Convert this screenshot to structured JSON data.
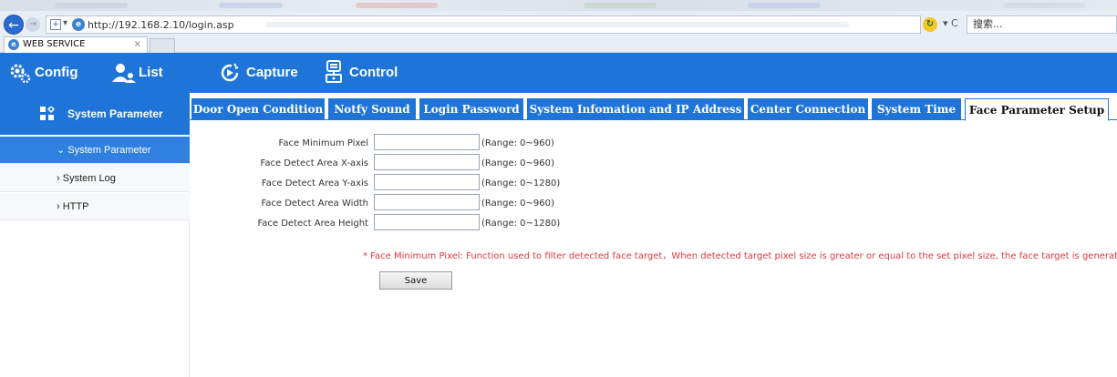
{
  "browser": {
    "url": "http://192.168.2.10/login.asp",
    "search_placeholder": "搜索...",
    "tab_title": "WEB SERVICE",
    "tab_close": "×"
  },
  "header": {
    "items": [
      {
        "label": "Config",
        "icon": "gear-icon"
      },
      {
        "label": "List",
        "icon": "users-icon"
      },
      {
        "label": "Capture",
        "icon": "capture-icon"
      },
      {
        "label": "Control",
        "icon": "control-icon"
      }
    ]
  },
  "sidebar": {
    "title": "System Parameter",
    "items": [
      {
        "label": "System Parameter",
        "active": true
      },
      {
        "label": "System Log",
        "active": false
      },
      {
        "label": "HTTP",
        "active": false
      }
    ]
  },
  "tabs": [
    {
      "label": "Door Open Condition",
      "active": false
    },
    {
      "label": "Notfy Sound",
      "active": false
    },
    {
      "label": "Login Password",
      "active": false
    },
    {
      "label": "System Infomation and IP Address",
      "active": false
    },
    {
      "label": "Center Connection",
      "active": false
    },
    {
      "label": "System Time",
      "active": false
    },
    {
      "label": "Face Parameter Setup",
      "active": true
    }
  ],
  "form": {
    "fields": [
      {
        "label": "Face Minimum Pixel",
        "value": "",
        "range": "(Range: 0~960)"
      },
      {
        "label": "Face Detect Area X-axis",
        "value": "",
        "range": "(Range: 0~960)"
      },
      {
        "label": "Face Detect Area Y-axis",
        "value": "",
        "range": "(Range: 0~1280)"
      },
      {
        "label": "Face Detect Area Width",
        "value": "",
        "range": "(Range: 0~960)"
      },
      {
        "label": "Face Detect Area Height",
        "value": "",
        "range": "(Range: 0~1280)"
      }
    ],
    "note": "* Face Minimum Pixel: Function used to filter detected face target，When detected target pixel size is greater or equal to the set pixel size, the face target is generated，pix",
    "save_label": "Save"
  },
  "colors": {
    "brand_blue": "#1f74d8",
    "active_item": "#2f80e0",
    "note_red": "#e03a3a"
  }
}
